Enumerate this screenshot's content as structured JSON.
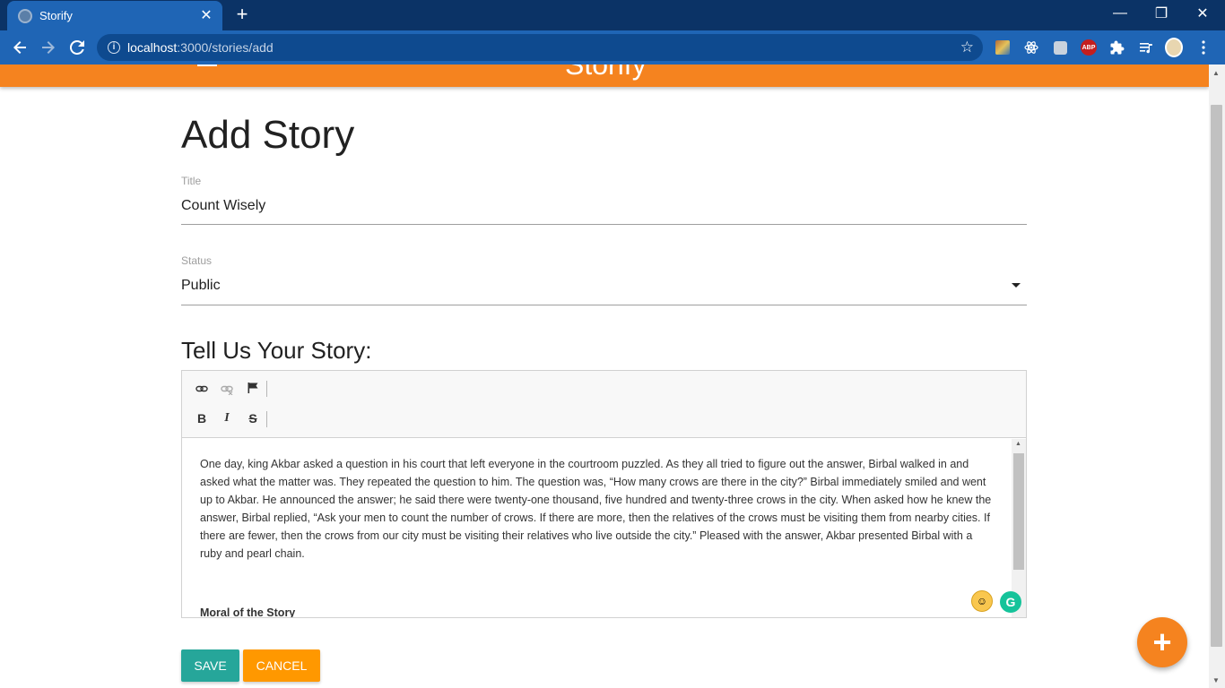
{
  "browser": {
    "tab_title": "Storify",
    "url_host": "localhost",
    "url_rest": ":3000/stories/add",
    "controls": {
      "minimize": "—",
      "restore": "❐",
      "close": "✕"
    }
  },
  "appbar": {
    "brand": "Storify"
  },
  "page": {
    "heading": "Add Story",
    "title_field": {
      "label": "Title",
      "value": "Count Wisely"
    },
    "status_field": {
      "label": "Status",
      "value": "Public"
    },
    "story_label": "Tell Us Your Story:",
    "editor": {
      "toolbar_row1": [
        "link-icon",
        "unlink-icon",
        "anchor-flag-icon"
      ],
      "toolbar_row2": {
        "bold": "B",
        "italic": "I",
        "strike": "S"
      },
      "body_paragraph": "One day, king Akbar asked a question in his court that left everyone in the courtroom puzzled. As they all tried to figure out the answer, Birbal walked in and asked what the matter was. They repeated the question to him. The question was, “How many crows are there in the city?” Birbal immediately smiled and went up to Akbar. He announced the answer; he said there were twenty-one thousand, five hundred and twenty-three crows in the city. When asked how he knew the answer, Birbal replied, “Ask your men to count the number of crows. If there are more, then the relatives of the crows must be visiting them from nearby cities. If there are fewer, then the crows from our city must be visiting their relatives who live outside the city.” Pleased with the answer, Akbar presented Birbal with a ruby and pearl chain.",
      "body_moral_heading": "Moral of the Story"
    },
    "save_label": "SAVE",
    "cancel_label": "CANCEL",
    "fab_label": "+"
  },
  "colors": {
    "accent": "#f5831f",
    "save": "#26a69a",
    "cancel": "#ff9800",
    "browser_frame": "#0b3366",
    "browser_toolbar": "#1f65b5"
  }
}
